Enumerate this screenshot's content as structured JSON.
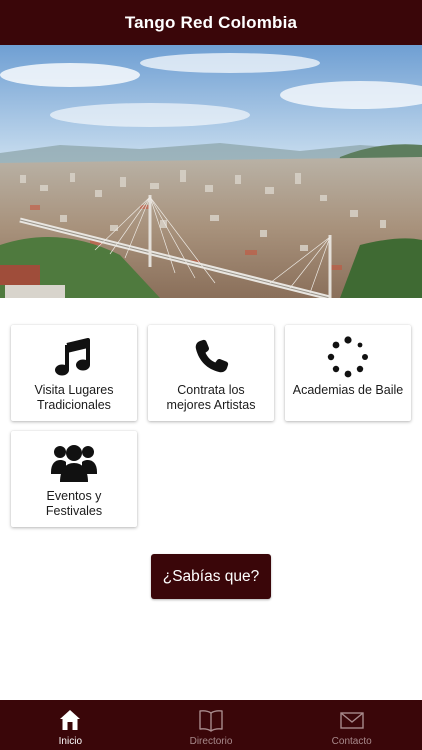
{
  "app": {
    "title": "Tango Red Colombia"
  },
  "hero": {
    "image": "city-panorama-bridge"
  },
  "tiles": [
    {
      "label_line1": "Visita Lugares",
      "label_line2": "Tradicionales",
      "icon": "music-note-icon"
    },
    {
      "label_line1": "Contrata los",
      "label_line2": "mejores Artistas",
      "icon": "phone-icon"
    },
    {
      "label_line1": "Academias de Baile",
      "label_line2": "",
      "icon": "spinner-icon"
    },
    {
      "label_line1": "Eventos y",
      "label_line2": "Festivales",
      "icon": "group-icon"
    }
  ],
  "cta": {
    "label": "¿Sabías que?"
  },
  "tabbar": {
    "active": "Inicio",
    "items": [
      {
        "label": "Inicio",
        "icon": "home-icon"
      },
      {
        "label": "Directorio",
        "icon": "book-icon"
      },
      {
        "label": "Contacto",
        "icon": "envelope-icon"
      }
    ]
  },
  "colors": {
    "brand": "#3a0609",
    "tab_inactive": "#a88a8c",
    "white": "#ffffff"
  }
}
